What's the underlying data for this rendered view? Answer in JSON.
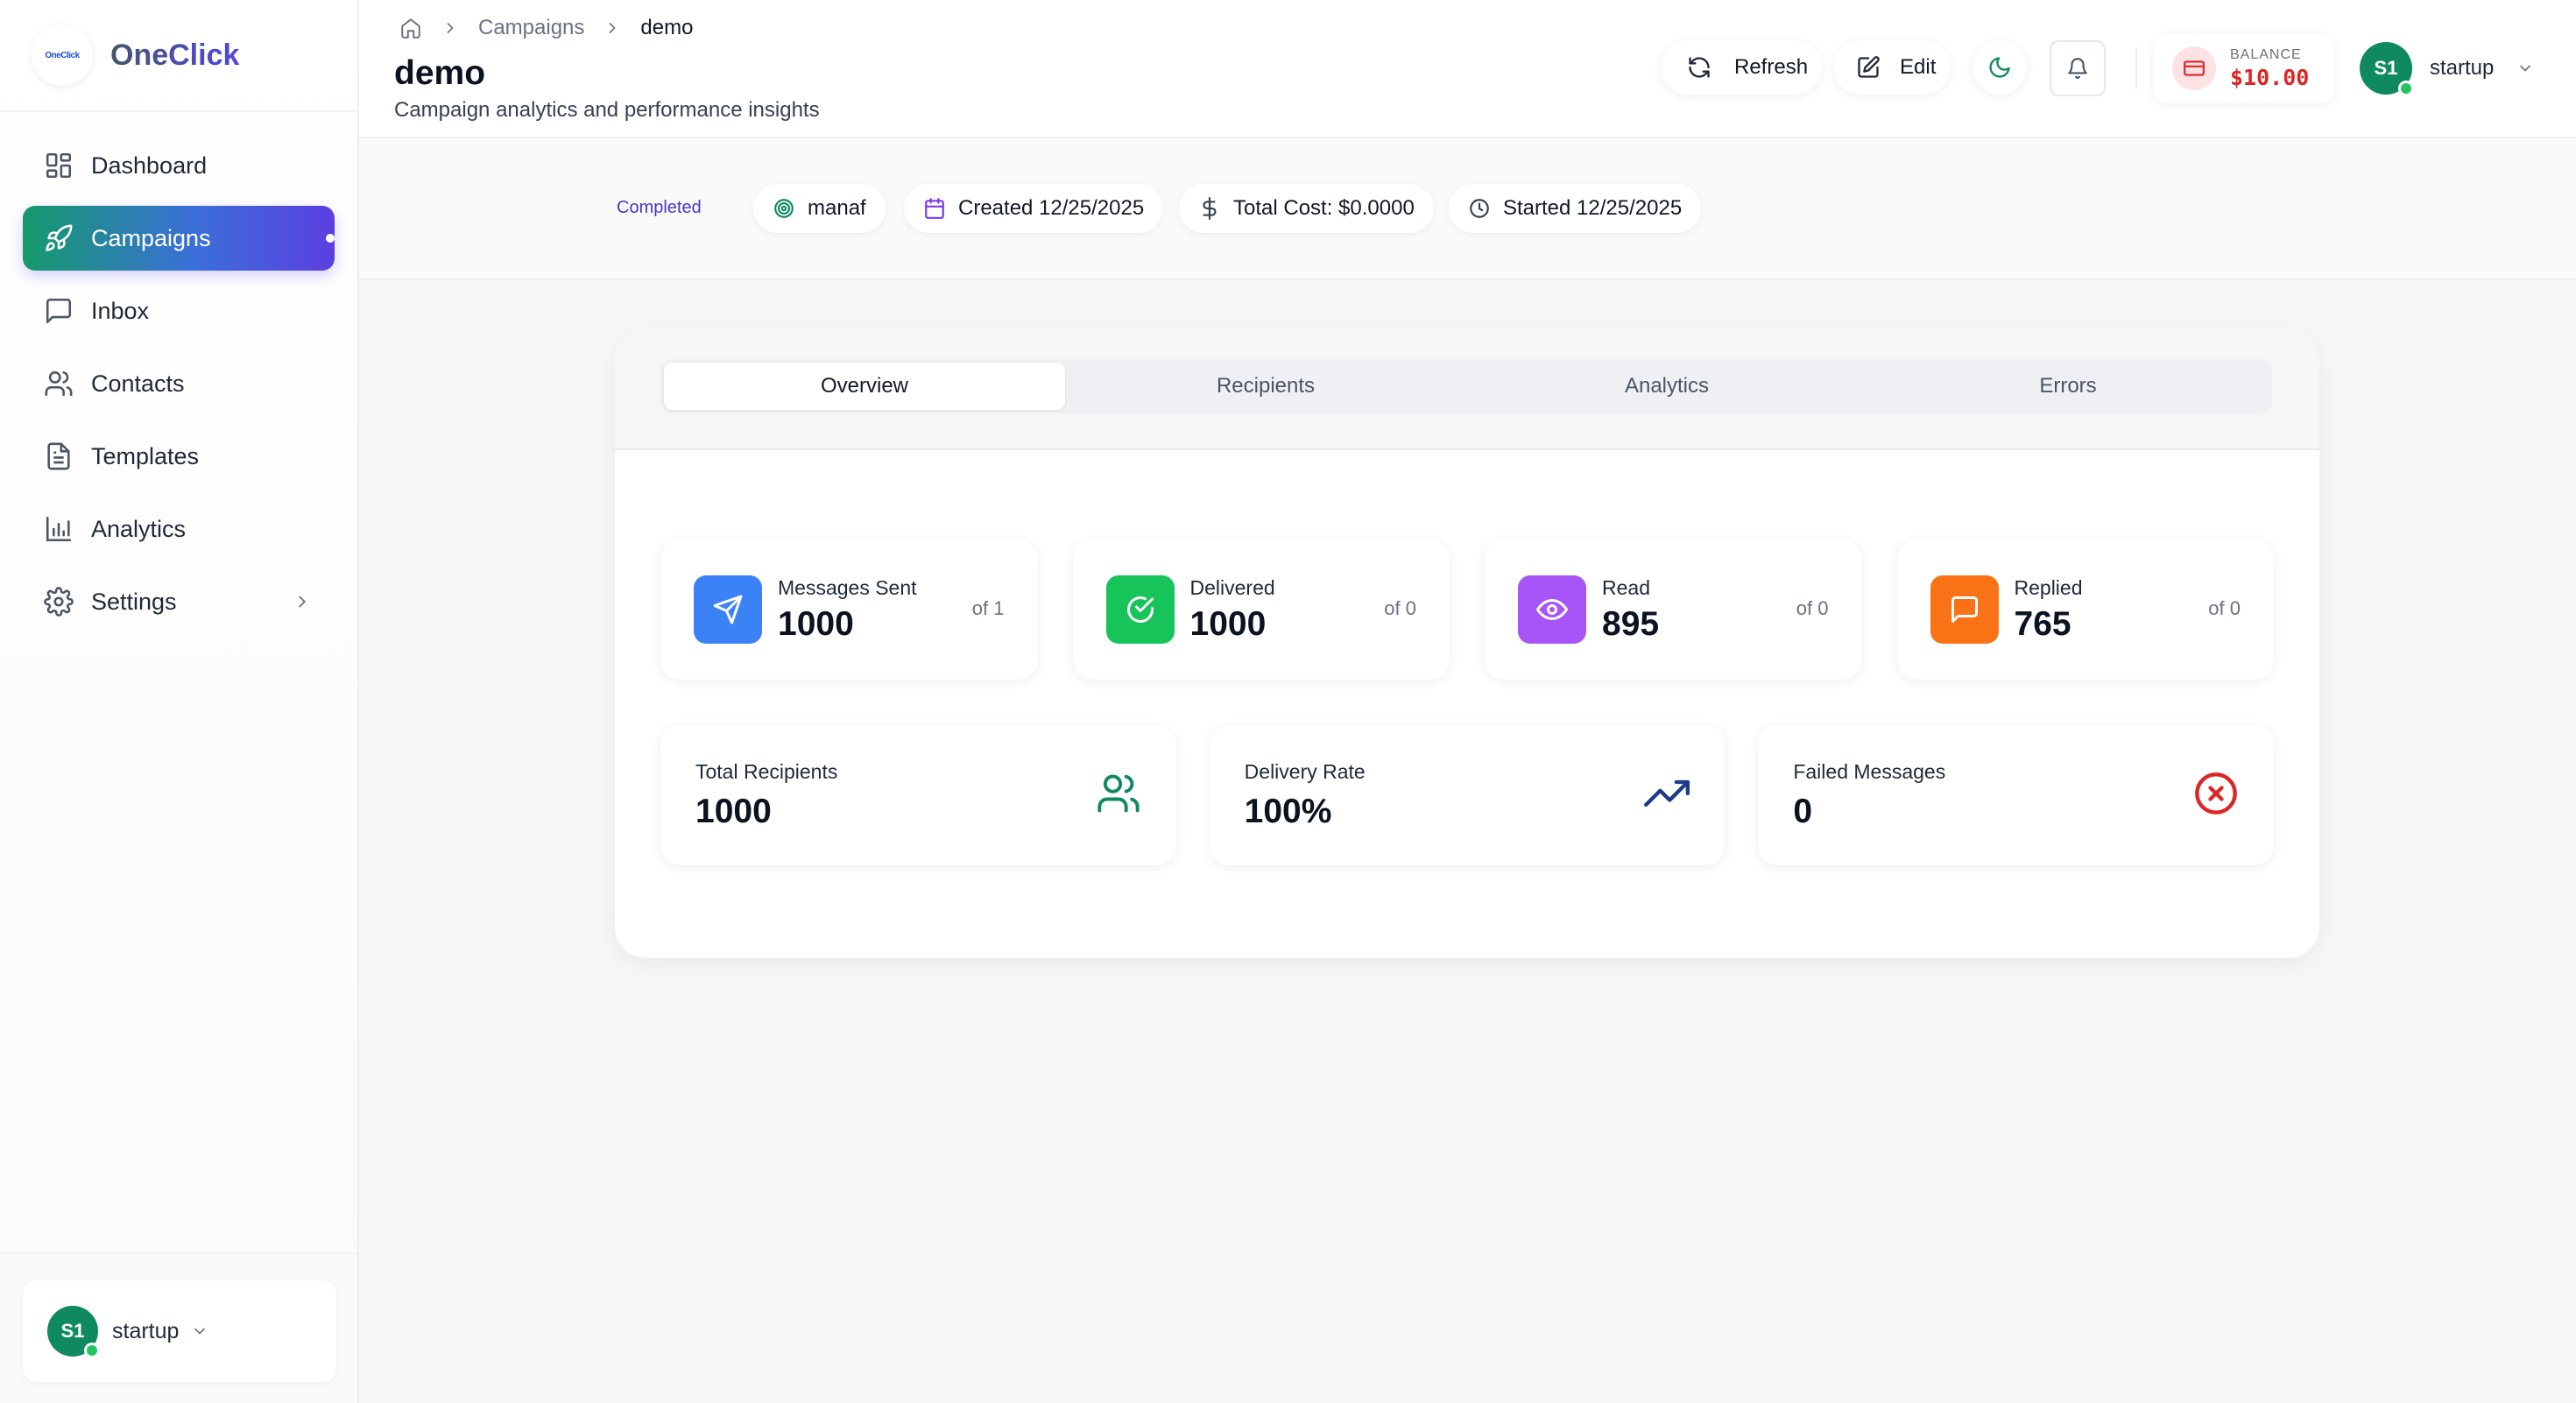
{
  "brand": {
    "name": "OneClick",
    "logo_text": "OneClick"
  },
  "sidebar": {
    "items": [
      {
        "label": "Dashboard",
        "icon": "dashboard-grid-icon"
      },
      {
        "label": "Campaigns",
        "icon": "rocket-icon",
        "active": true
      },
      {
        "label": "Inbox",
        "icon": "message-square-icon"
      },
      {
        "label": "Contacts",
        "icon": "users-icon"
      },
      {
        "label": "Templates",
        "icon": "file-text-icon"
      },
      {
        "label": "Analytics",
        "icon": "bar-chart-icon"
      },
      {
        "label": "Settings",
        "icon": "gear-icon",
        "has_submenu": true
      }
    ],
    "user": {
      "initials": "S1",
      "name": "startup"
    }
  },
  "breadcrumb": {
    "items": [
      "Campaigns",
      "demo"
    ]
  },
  "page": {
    "title": "demo",
    "subtitle": "Campaign analytics and performance insights"
  },
  "header": {
    "refresh_label": "Refresh",
    "edit_label": "Edit",
    "balance_label": "BALANCE",
    "balance_value": "$10.00",
    "user_initials": "S1",
    "user_name": "startup"
  },
  "meta": {
    "status": "Completed",
    "owner": "manaf",
    "created": "Created 12/25/2025",
    "total_cost": "Total Cost: $0.0000",
    "started": "Started 12/25/2025"
  },
  "tabs": [
    "Overview",
    "Recipients",
    "Analytics",
    "Errors"
  ],
  "active_tab": "Overview",
  "stats": [
    {
      "label": "Messages Sent",
      "value": "1000",
      "of": "of 1",
      "color": "#3b82f6",
      "icon": "send-icon"
    },
    {
      "label": "Delivered",
      "value": "1000",
      "of": "of 0",
      "color": "#16c45a",
      "icon": "check-circle-icon"
    },
    {
      "label": "Read",
      "value": "895",
      "of": "of 0",
      "color": "#a855f7",
      "icon": "eye-icon"
    },
    {
      "label": "Replied",
      "value": "765",
      "of": "of 0",
      "color": "#f97316",
      "icon": "message-square-icon"
    }
  ],
  "summary": [
    {
      "label": "Total Recipients",
      "value": "1000",
      "icon": "users-icon",
      "color": "#0f8a5f"
    },
    {
      "label": "Delivery Rate",
      "value": "100%",
      "icon": "trending-up-icon",
      "color": "#1e3a8a"
    },
    {
      "label": "Failed Messages",
      "value": "0",
      "icon": "x-circle-icon",
      "color": "#dc2626"
    }
  ],
  "colors": {
    "accent": "#0f8a5f",
    "active_gradient": [
      "#149a6c",
      "#5b3fe0"
    ],
    "danger": "#dc2626"
  }
}
